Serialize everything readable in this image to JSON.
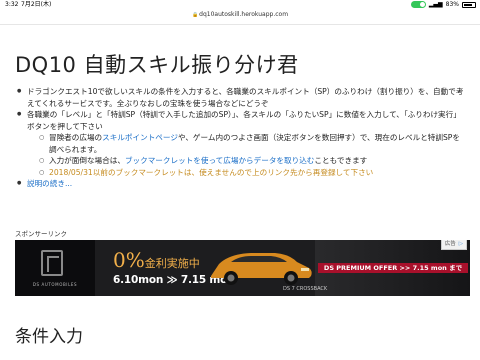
{
  "statusbar": {
    "time": "3:32",
    "date": "7月2日(木)",
    "battery_text": "83%",
    "battery_level": 0.83
  },
  "browser": {
    "url": "dq10autoskill.herokuapp.com"
  },
  "page": {
    "title": "DQ10 自動スキル振り分け君",
    "bullets": [
      "ドラゴンクエスト10で欲しいスキルの条件を入力すると、各職業のスキルポイント（SP）のふりわけ（割り振り）を、自動で考えてくれるサービスです。全ぶりなおしの宝珠を使う場合などにどうぞ",
      "各職業の「レベル」と「特訓SP（特訓で入手した追加のSP）」、各スキルの「ふりたいSP」に数値を入力して、「ふりわけ実行」ボタンを押して下さい"
    ],
    "sub1": {
      "prefix": "冒険者の広場の",
      "link": "スキルポイントページ",
      "suffix": "や、ゲーム内のつよさ画面（決定ボタンを数回押す）で、現在のレベルと特訓SPを調べられます。"
    },
    "sub2": {
      "prefix": "入力が面倒な場合は、",
      "link": "ブックマークレットを使って広場からデータを取り込む",
      "suffix": "こともできます"
    },
    "sub3": "2018/05/31以前のブックマークレットは、使えませんので上のリンク先から再登録して下さい",
    "more_link": "説明の続き...",
    "sponsor_label": "スポンサーリンク",
    "section_title": "条件入力"
  },
  "ad": {
    "tag": "広告",
    "tag_close": "▷",
    "brand": "DS AUTOMOBILES",
    "headline_num": "0%",
    "headline_text": "金利実施中",
    "dates": "6.10mon ≫ 7.15 mon",
    "model": "DS 7 CROSSBACK",
    "offer": "DS PREMIUM OFFER >> 7.15 mon まで",
    "offer_color": "#a8102b",
    "accent_color": "#f2b04a"
  }
}
